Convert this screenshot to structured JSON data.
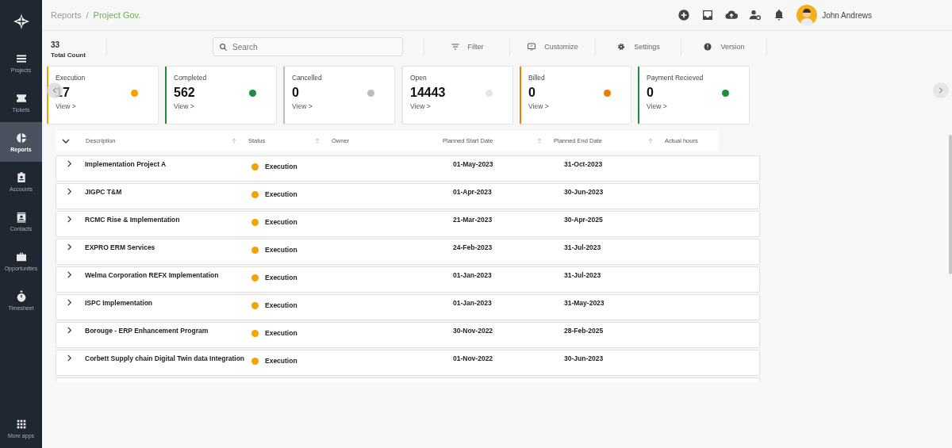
{
  "sidebar": {
    "items": [
      {
        "label": "Projects",
        "selected": false
      },
      {
        "label": "Tickets",
        "selected": false
      },
      {
        "label": "Reports",
        "selected": true
      },
      {
        "label": "Accounts",
        "selected": false
      },
      {
        "label": "Contacts",
        "selected": false
      },
      {
        "label": "Opportunities",
        "selected": false
      },
      {
        "label": "Timesheet",
        "selected": false
      }
    ],
    "more_apps": "More apps"
  },
  "breadcrumb": [
    "Reports",
    "Project Gov."
  ],
  "breadcrumb_separator": "/",
  "user": {
    "name": "John Andrews"
  },
  "total": {
    "count": "33",
    "label": "Total Count"
  },
  "search": {
    "placeholder": "Search"
  },
  "toolbar": [
    "Filter",
    "Customize",
    "Settings",
    "Version"
  ],
  "cards": [
    {
      "title": "Execution",
      "value": "17",
      "link": "View >",
      "color": "#f5a300"
    },
    {
      "title": "Completed",
      "value": "562",
      "link": "View >",
      "color": "#1e8e3e"
    },
    {
      "title": "Cancelled",
      "value": "0",
      "link": "View >",
      "color": "#bdbdbd"
    },
    {
      "title": "Open",
      "value": "14443",
      "link": "View >",
      "color": "#e6e6e6"
    },
    {
      "title": "Billed",
      "value": "0",
      "link": "View >",
      "color": "#ef7d00"
    },
    {
      "title": "Payment Recieved",
      "value": "0",
      "link": "View >",
      "color": "#1e8e3e"
    }
  ],
  "table": {
    "columns": [
      "Description",
      "Status",
      "Owner",
      "Planned Start Date",
      "Planned End Date",
      "Actual hours"
    ],
    "rows": [
      {
        "description": "Implementation Project A",
        "status": "Execution",
        "color": "#f5a300",
        "start": "01-May-2023",
        "end": "31-Oct-2023"
      },
      {
        "description": "JIGPC T&M",
        "status": "Execution",
        "color": "#f5a300",
        "start": "01-Apr-2023",
        "end": "30-Jun-2023"
      },
      {
        "description": "RCMC Rise & Implementation",
        "status": "Execution",
        "color": "#f5a300",
        "start": "21-Mar-2023",
        "end": "30-Apr-2025"
      },
      {
        "description": "EXPRO ERM Services",
        "status": "Execution",
        "color": "#f5a300",
        "start": "24-Feb-2023",
        "end": "31-Jul-2023"
      },
      {
        "description": "Welma Corporation REFX Implementation",
        "status": "Execution",
        "color": "#f5a300",
        "start": "01-Jan-2023",
        "end": "31-Jul-2023"
      },
      {
        "description": "ISPC Implementation",
        "status": "Execution",
        "color": "#f5a300",
        "start": "01-Jan-2023",
        "end": "31-May-2023"
      },
      {
        "description": "Borouge - ERP Enhancement Program",
        "status": "Execution",
        "color": "#f5a300",
        "start": "30-Nov-2022",
        "end": "28-Feb-2025"
      },
      {
        "description": "Corbett Supply chain Digital Twin data Integration",
        "status": "Execution",
        "color": "#f5a300",
        "start": "01-Nov-2022",
        "end": "30-Jun-2023"
      }
    ]
  }
}
